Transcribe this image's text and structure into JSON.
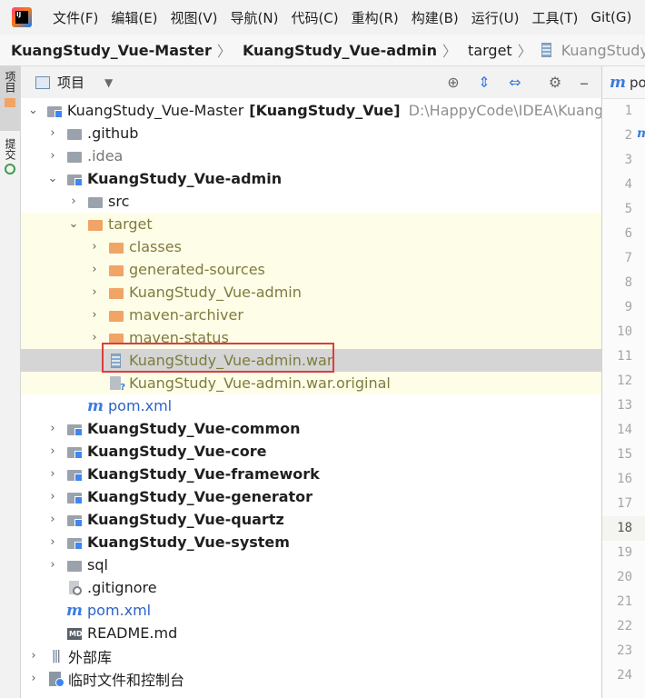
{
  "menu": [
    "文件(F)",
    "编辑(E)",
    "视图(V)",
    "导航(N)",
    "代码(C)",
    "重构(R)",
    "构建(B)",
    "运行(U)",
    "工具(T)",
    "Git(G)"
  ],
  "breadcrumb": {
    "project": "KuangStudy_Vue-Master",
    "module": "KuangStudy_Vue-admin",
    "folder": "target",
    "file": "KuangStudy_Vue-admin.war"
  },
  "left_strip": {
    "project_tab": "项目",
    "commit_tab": "提交"
  },
  "panel": {
    "title": "项目"
  },
  "tree": {
    "root": {
      "name": "KuangStudy_Vue-Master",
      "module": "[KuangStudy_Vue]",
      "path": "D:\\HappyCode\\IDEA\\KuangStudy_Vue"
    },
    "github": ".github",
    "idea": ".idea",
    "admin": "KuangStudy_Vue-admin",
    "src": "src",
    "target": "target",
    "classes": "classes",
    "generated": "generated-sources",
    "admin_folder": "KuangStudy_Vue-admin",
    "maven_archiver": "maven-archiver",
    "maven_status": "maven-status",
    "war": "KuangStudy_Vue-admin.war",
    "war_original": "KuangStudy_Vue-admin.war.original",
    "admin_pom": "pom.xml",
    "common": "KuangStudy_Vue-common",
    "core": "KuangStudy_Vue-core",
    "framework": "KuangStudy_Vue-framework",
    "generator": "KuangStudy_Vue-generator",
    "quartz": "KuangStudy_Vue-quartz",
    "system": "KuangStudy_Vue-system",
    "sql": "sql",
    "gitignore": ".gitignore",
    "root_pom": "pom.xml",
    "readme": "README.md",
    "external_libs": "外部库",
    "scratches": "临时文件和控制台"
  },
  "editor": {
    "tab_label": "pom.xml",
    "line_numbers": [
      "1",
      "2",
      "3",
      "4",
      "5",
      "6",
      "7",
      "8",
      "9",
      "10",
      "11",
      "12",
      "13",
      "14",
      "15",
      "16",
      "17",
      "18",
      "19",
      "20",
      "21",
      "22",
      "23",
      "24"
    ],
    "current_line": "18"
  }
}
